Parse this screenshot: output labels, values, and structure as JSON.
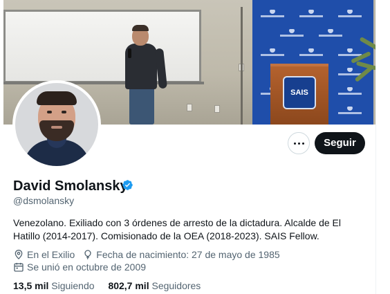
{
  "profile": {
    "display_name": "David Smolansky",
    "handle": "@dsmolansky",
    "bio": "Venezolano. Exiliado con 3 órdenes de arresto de la dictadura. Alcalde de El Hatillo (2014-2017). Comisionado de la OEA (2018-2023). SAIS Fellow.",
    "location": "En el Exilio",
    "birthdate": "Fecha de nacimiento: 27 de mayo de 1985",
    "joined": "Se unió en octubre de 2009",
    "following_count": "13,5 mil",
    "following_label": "Siguiendo",
    "followers_count": "802,7 mil",
    "followers_label": "Seguidores"
  },
  "actions": {
    "follow_label": "Seguir",
    "more_icon": "ellipsis-icon"
  },
  "banner": {
    "podium_text": "SAIS"
  },
  "icons": {
    "verified": "verified-badge-icon",
    "location": "location-pin-icon",
    "birthdate": "balloon-icon",
    "joined": "calendar-icon"
  },
  "colors": {
    "verified_blue": "#1d9bf0",
    "follow_button_bg": "#0f1419",
    "secondary_text": "#536471",
    "banner_backdrop": "#1f4eaa"
  }
}
